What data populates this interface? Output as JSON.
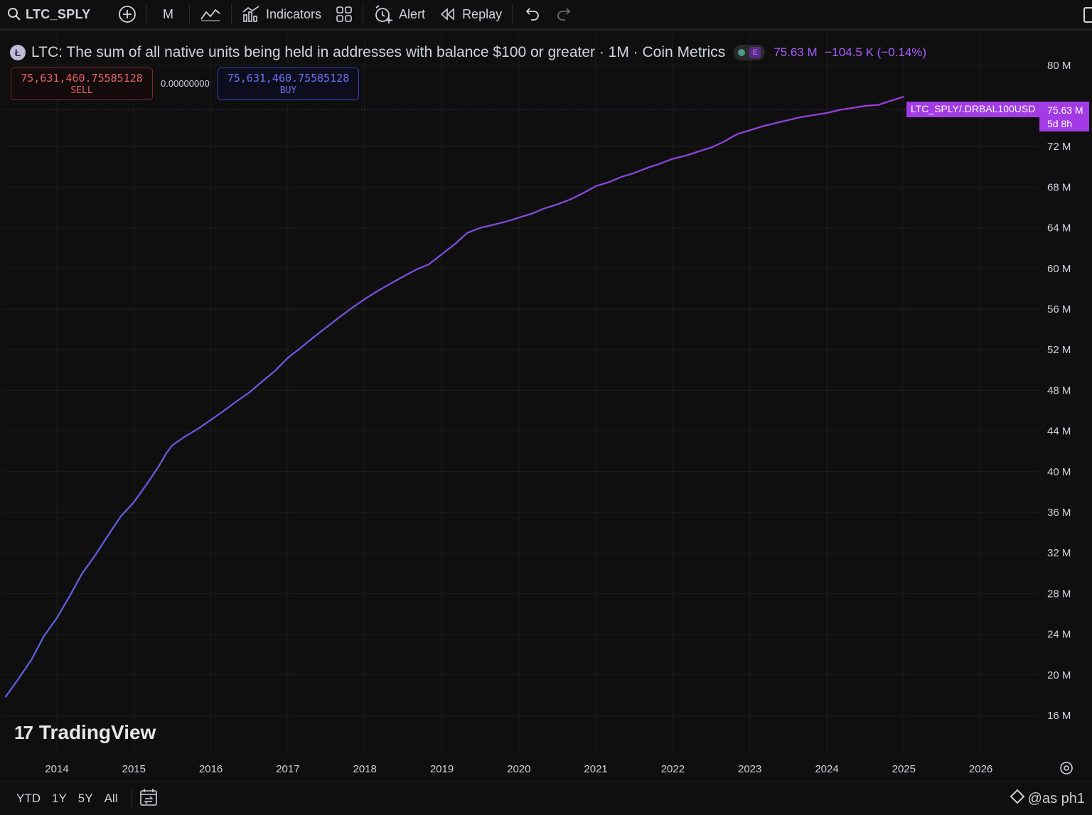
{
  "toolbar": {
    "symbol": "LTC_SPLY",
    "interval": "M",
    "indicators_label": "Indicators",
    "alert_label": "Alert",
    "replay_label": "Replay"
  },
  "legend": {
    "logo_letter": "Ł",
    "title": "LTC: The sum of all native units being held in addresses with balance $100 or greater · 1M · Coin Metrics",
    "status_letter": "E",
    "last_value": "75.63 M",
    "change": "−104.5 K (−0.14%)"
  },
  "trade": {
    "sell_price": "75,631,460.75585128",
    "sell_label": "SELL",
    "spread": "0.00000000",
    "buy_price": "75,631,460.75585128",
    "buy_label": "BUY"
  },
  "price_tag": {
    "series_name": "LTC_SPLY/.DRBAL100USD",
    "value": "75.63 M",
    "countdown": "5d 8h"
  },
  "branding": {
    "name": "TradingView",
    "mark": "17"
  },
  "bottom": {
    "ranges": [
      "YTD",
      "1Y",
      "5Y",
      "All"
    ],
    "watermark": "@as ph1"
  },
  "colors": {
    "line_start": "#5d62e6",
    "line_end": "#a23be6",
    "background": "#0f0f0f",
    "grid": "#1c1c1c"
  },
  "chart_data": {
    "type": "line",
    "title": "LTC: The sum of all native units being held in addresses with balance $100 or greater · 1M · Coin Metrics",
    "xlabel": "",
    "ylabel": "",
    "x_ticks": [
      "2014",
      "2015",
      "2016",
      "2017",
      "2018",
      "2019",
      "2020",
      "2021",
      "2022",
      "2023",
      "2024",
      "2025",
      "2026"
    ],
    "y_ticks": [
      "16 M",
      "20 M",
      "24 M",
      "28 M",
      "32 M",
      "36 M",
      "40 M",
      "44 M",
      "48 M",
      "52 M",
      "56 M",
      "60 M",
      "64 M",
      "68 M",
      "72 M",
      "80 M"
    ],
    "ylim": [
      13,
      81
    ],
    "xlim": [
      2013.3,
      2026.8
    ],
    "grid": true,
    "series": [
      {
        "name": "LTC_SPLY/.DRBAL100USD",
        "x": [
          2013.33,
          2013.5,
          2013.67,
          2013.83,
          2014.0,
          2014.17,
          2014.33,
          2014.5,
          2014.67,
          2014.83,
          2015.0,
          2015.17,
          2015.33,
          2015.42,
          2015.5,
          2015.67,
          2015.83,
          2016.0,
          2016.17,
          2016.33,
          2016.5,
          2016.67,
          2016.83,
          2017.0,
          2017.17,
          2017.33,
          2017.5,
          2017.67,
          2017.83,
          2018.0,
          2018.17,
          2018.33,
          2018.5,
          2018.67,
          2018.83,
          2019.0,
          2019.17,
          2019.33,
          2019.5,
          2019.67,
          2019.83,
          2020.0,
          2020.17,
          2020.33,
          2020.5,
          2020.67,
          2020.83,
          2021.0,
          2021.17,
          2021.33,
          2021.5,
          2021.67,
          2021.83,
          2022.0,
          2022.17,
          2022.33,
          2022.5,
          2022.67,
          2022.83,
          2023.0,
          2023.17,
          2023.33,
          2023.5,
          2023.67,
          2023.83,
          2024.0,
          2024.17,
          2024.33,
          2024.5,
          2024.67,
          2024.83,
          2025.0
        ],
        "values": [
          17.8,
          19.6,
          21.5,
          23.8,
          25.6,
          27.8,
          30.0,
          31.8,
          33.8,
          35.6,
          37.0,
          38.8,
          40.6,
          41.8,
          42.6,
          43.5,
          44.2,
          45.1,
          46.0,
          46.9,
          47.8,
          48.9,
          49.9,
          51.2,
          52.2,
          53.2,
          54.2,
          55.2,
          56.1,
          57.0,
          57.8,
          58.5,
          59.2,
          59.9,
          60.4,
          61.4,
          62.4,
          63.5,
          64.0,
          64.3,
          64.6,
          65.0,
          65.4,
          65.9,
          66.3,
          66.8,
          67.4,
          68.1,
          68.5,
          69.0,
          69.4,
          69.9,
          70.3,
          70.8,
          71.1,
          71.5,
          71.9,
          72.5,
          73.2,
          73.6,
          74.0,
          74.3,
          74.6,
          74.9,
          75.1,
          75.3,
          75.6,
          75.8,
          76.0,
          76.1,
          76.5,
          76.9
        ]
      }
    ]
  }
}
